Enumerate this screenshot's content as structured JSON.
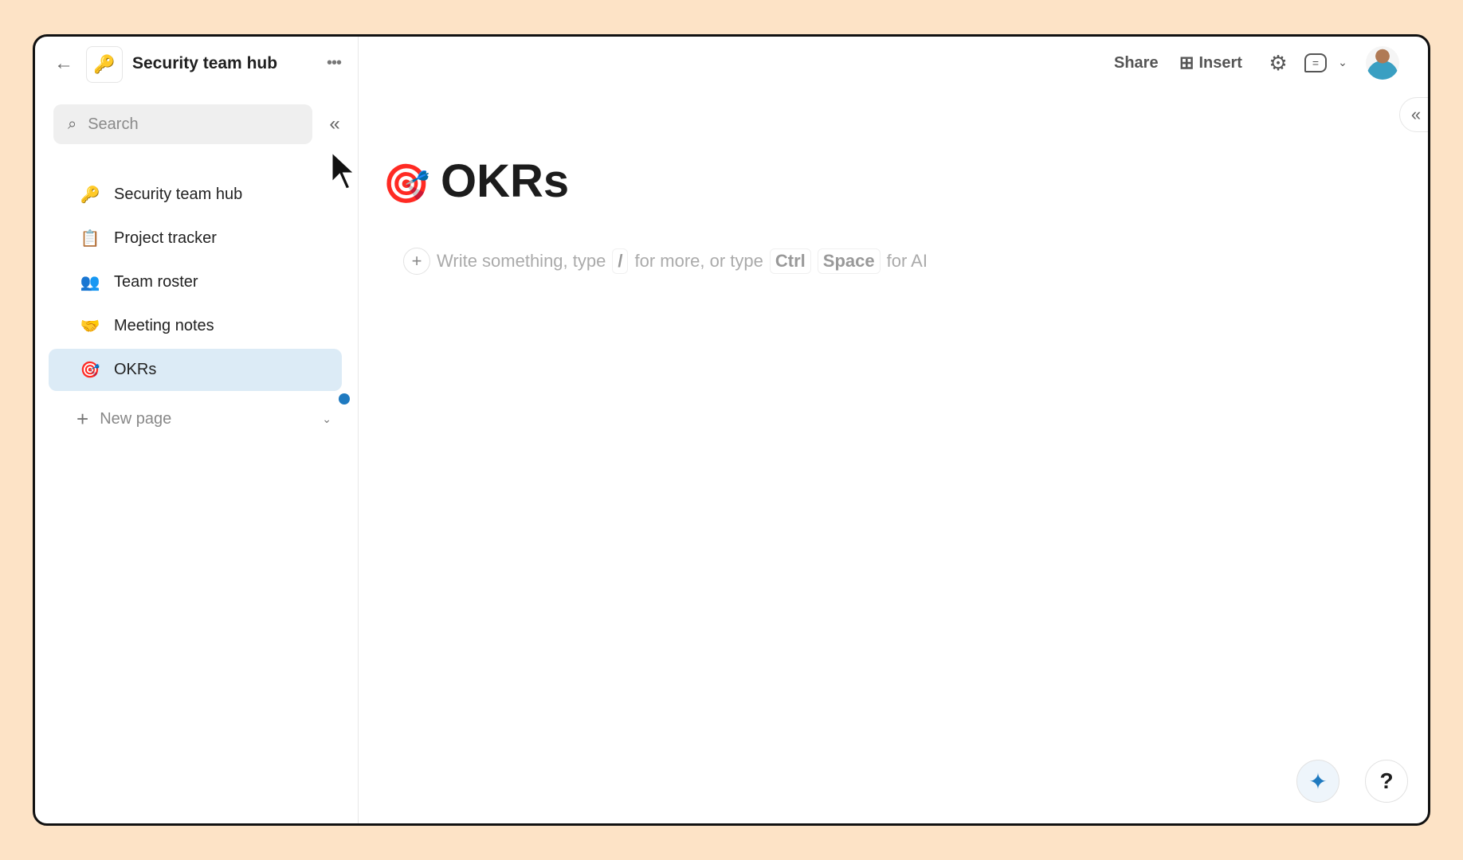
{
  "sidebar": {
    "workspace_title": "Security team hub",
    "search_placeholder": "Search",
    "items": [
      {
        "icon": "🔑",
        "label": "Security team hub"
      },
      {
        "icon": "📋",
        "label": "Project tracker"
      },
      {
        "icon": "👥",
        "label": "Team roster"
      },
      {
        "icon": "🤝",
        "label": "Meeting notes"
      },
      {
        "icon": "🎯",
        "label": "OKRs"
      }
    ],
    "new_page_label": "New page"
  },
  "toolbar": {
    "share_label": "Share",
    "insert_label": "Insert"
  },
  "page": {
    "icon": "🎯",
    "title": "OKRs",
    "placeholder": {
      "part1": "Write something, type",
      "slash": "/",
      "part2": "for more, or type",
      "key1": "Ctrl",
      "key2": "Space",
      "part3": "for AI"
    }
  },
  "help_label": "?",
  "colors": {
    "accent": "#1f7ac0",
    "selected_bg": "#dcebf6",
    "background": "#fde3c6"
  }
}
